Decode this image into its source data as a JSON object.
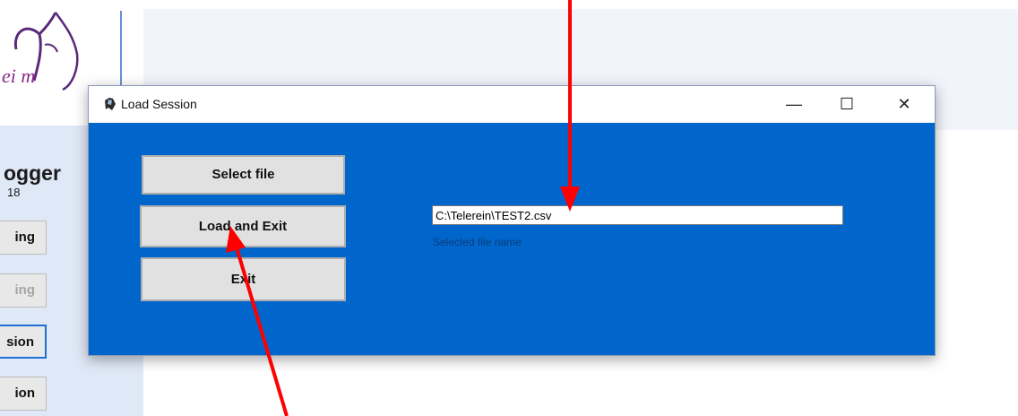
{
  "app": {
    "logo_text": "ei m",
    "title": "ogger",
    "subtitle": "18",
    "side_buttons": [
      {
        "label": "ing",
        "state": "normal"
      },
      {
        "label": "ing",
        "state": "disabled"
      },
      {
        "label": "sion",
        "state": "active"
      },
      {
        "label": "ion",
        "state": "normal"
      }
    ]
  },
  "dialog": {
    "title": "Load Session",
    "controls": {
      "minimize": "—",
      "maximize": "☐",
      "close": "✕"
    },
    "buttons": {
      "select_file": "Select file",
      "load_and_exit": "Load and Exit",
      "exit": "Exit"
    },
    "file_path": "C:\\Telerein\\TEST2.csv",
    "file_label": "Selected file name"
  },
  "colors": {
    "client_bg": "#0066cc",
    "annotation_arrow": "#ff0000"
  }
}
